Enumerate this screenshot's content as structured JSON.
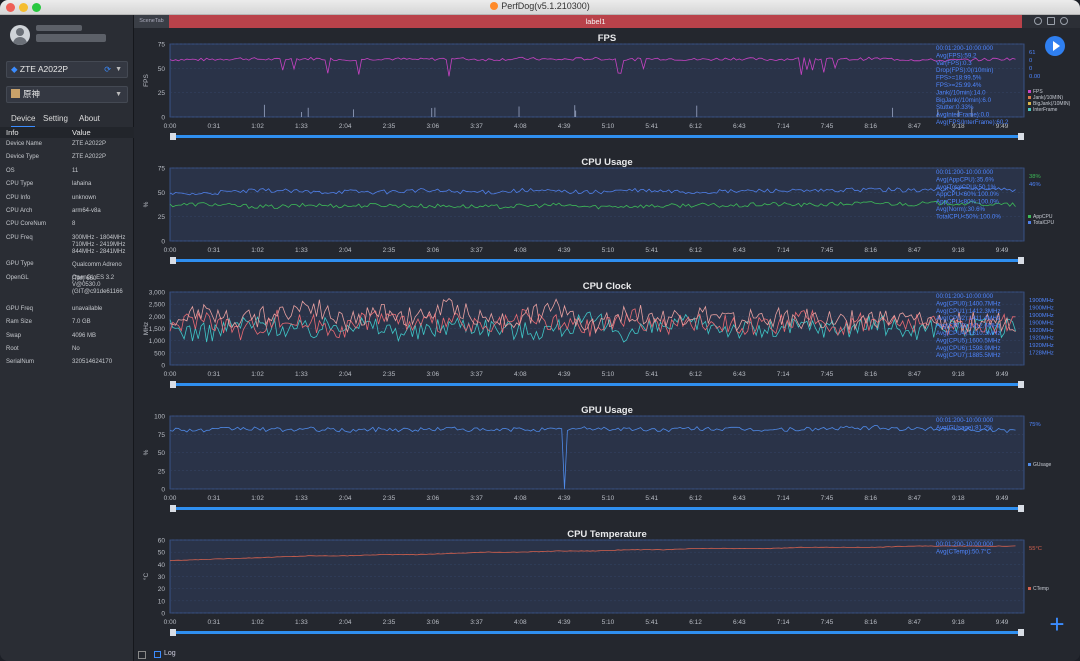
{
  "window": {
    "title": "PerfDog(v5.1.210300)",
    "tab_scene": "SceneTab",
    "tab_label": "label1",
    "status_log": "Log"
  },
  "sidebar": {
    "device_select": "ZTE A2022P",
    "app_select": "原神",
    "tabs": [
      "Device",
      "Setting",
      "About"
    ],
    "info_header": {
      "key": "Info",
      "value": "Value"
    },
    "rows": [
      {
        "k": "Device Name",
        "v": "ZTE A2022P"
      },
      {
        "k": "Device Type",
        "v": "ZTE A2022P"
      },
      {
        "k": "OS",
        "v": "11"
      },
      {
        "k": "CPU Type",
        "v": "lahaina"
      },
      {
        "k": "CPU Info",
        "v": "unknown"
      },
      {
        "k": "CPU Arch",
        "v": "arm64-v8a"
      },
      {
        "k": "CPU CoreNum",
        "v": "8"
      },
      {
        "k": "CPU Freq",
        "v": "300MHz - 1804MHz\n710MHz - 2419MHz\n844MHz - 2841MHz"
      },
      {
        "k": "GPU Type",
        "v": "Qualcomm Adreno (TM) 660"
      },
      {
        "k": "OpenGL",
        "v": "OpenGL ES 3.2 V@0530.0 (GIT@c91de61166"
      },
      {
        "k": "GPU Freq",
        "v": "unavailable"
      },
      {
        "k": "Ram Size",
        "v": "7.0 GB"
      },
      {
        "k": "Swap",
        "v": "4096 MB"
      },
      {
        "k": "Root",
        "v": "No"
      },
      {
        "k": "SerialNum",
        "v": "320514624170"
      }
    ]
  },
  "colors": {
    "accent": "#2f7ff0",
    "label_bar": "#b9424a",
    "plot_bg": "#2a3348",
    "fps": "#c843c4",
    "app_cpu": "#3dbb58",
    "total_cpu": "#4f7fe8",
    "gpu": "#4f8ae8",
    "temp": "#d4614e"
  },
  "x_ticks": [
    "0:00",
    "0:31",
    "1:02",
    "1:33",
    "2:04",
    "2:35",
    "3:06",
    "3:37",
    "4:08",
    "4:39",
    "5:10",
    "5:41",
    "6:12",
    "6:43",
    "7:14",
    "7:45",
    "8:16",
    "8:47",
    "9:18",
    "9:49"
  ],
  "chart_data": [
    {
      "type": "line",
      "title": "FPS",
      "ylabel": "FPS",
      "ylim": [
        0,
        75
      ],
      "yticks": [
        "0",
        "25",
        "50",
        "75"
      ],
      "stats": [
        "00:01:200-10:00:000",
        "Avg(FPS):59.2",
        "Var(FPS):0.3",
        "Drop(FPS):0(/10min)",
        "FPS>=18:99.5%",
        "FPS>=25:99.4%",
        "Jank(/10min):14.0",
        "BigJank(/10min):6.0",
        "Stutter:0.33%",
        "AvgInterFrame):0.0",
        "Avg(FPS/InterFrame):60.2"
      ],
      "current_values": [
        "61",
        "0",
        "0",
        "0.00"
      ],
      "legend": [
        "FPS",
        "Jank(/10MIN)",
        "BigJank(/10MIN)",
        "InterFrame"
      ],
      "legend_colors": [
        "#c843c4",
        "#d97a4c",
        "#d9b54c",
        "#4cc9c0"
      ],
      "series": [
        {
          "name": "FPS",
          "values": [
            59,
            59,
            60,
            59,
            60,
            59,
            60,
            59,
            60,
            59,
            60,
            59,
            60,
            59,
            60,
            59,
            60,
            59,
            60,
            59,
            60,
            59,
            58,
            59,
            60
          ]
        }
      ]
    },
    {
      "type": "line",
      "title": "CPU Usage",
      "ylabel": "%",
      "ylim": [
        0,
        75
      ],
      "yticks": [
        "0",
        "25",
        "50",
        "75"
      ],
      "stats": [
        "00:01:200-10:00:000",
        "Avg(AppCPU):35.6%",
        "Avg(TotalCPU):50.1%",
        "AppCPU<60%:100.0%",
        "AppCPU<80%:100.0%",
        "Avg(Norm):30.6%",
        "TotalCPU<50%:100.0%"
      ],
      "current_values": [
        "38%",
        "46%"
      ],
      "legend": [
        "AppCPU",
        "TotalCPU"
      ],
      "series": [
        {
          "name": "AppCPU",
          "values": [
            37,
            38,
            36,
            35,
            37,
            36,
            37,
            36,
            36,
            35,
            36,
            37,
            35,
            36,
            36,
            37,
            36,
            38,
            37,
            38,
            39,
            38,
            39,
            38,
            37
          ]
        },
        {
          "name": "TotalCPU",
          "values": [
            48,
            49,
            51,
            52,
            50,
            51,
            50,
            52,
            51,
            50,
            52,
            51,
            50,
            52,
            51,
            50,
            51,
            52,
            51,
            52,
            53,
            52,
            53,
            54,
            52
          ]
        }
      ]
    },
    {
      "type": "line",
      "title": "CPU Clock",
      "ylabel": "MHz",
      "ylim": [
        0,
        3000
      ],
      "yticks": [
        "0",
        "500",
        "1,000",
        "1,500",
        "2,000",
        "2,500",
        "3,000"
      ],
      "stats": [
        "00:01:200-10:00:000",
        "Avg(CPU0):1400.7MHz",
        "Avg(CPU1):1412.3MHz",
        "Avg(CPU2):1411.4MHz",
        "Avg(CPU3):1412.6MHz",
        "Avg(CPU4):1610.3MHz",
        "Avg(CPU5):1600.5MHz",
        "Avg(CPU6):1598.9MHz",
        "Avg(CPU7):1885.5MHz"
      ],
      "current_values": [
        "1900MHz",
        "1900MHz",
        "1900MHz",
        "1900MHz",
        "1920MHz",
        "1920MHz",
        "1920MHz",
        "1728MHz"
      ],
      "series": [
        {
          "name": "CPU0-3",
          "values": [
            1500,
            1300,
            1700,
            1600,
            1400,
            1800,
            1500,
            1300,
            1700,
            1600,
            1400,
            1500,
            1800,
            1300,
            1600,
            1700,
            1500,
            1400,
            1600,
            1500,
            1700,
            1400,
            1600,
            1500,
            1500
          ]
        },
        {
          "name": "CPU4-6",
          "values": [
            1600,
            2000,
            1400,
            1900,
            1700,
            1500,
            2100,
            1600,
            1800,
            1400,
            1900,
            1700,
            1500,
            2000,
            1600,
            1800,
            1700,
            1500,
            1900,
            1600,
            1800,
            1700,
            1600,
            1700,
            1650
          ]
        },
        {
          "name": "CPU7",
          "values": [
            1900,
            2300,
            1800,
            2100,
            2500,
            1700,
            2200,
            1900,
            2400,
            1800,
            2000,
            2300,
            1700,
            2200,
            1900,
            2100,
            1800,
            2000,
            1900,
            1800,
            1900,
            1800,
            1750,
            1800,
            1728
          ]
        }
      ]
    },
    {
      "type": "line",
      "title": "GPU Usage",
      "ylabel": "%",
      "ylim": [
        0,
        100
      ],
      "yticks": [
        "0",
        "25",
        "50",
        "75",
        "100"
      ],
      "stats": [
        "00:01:200-10:00:000",
        "Avg(GUsage):81.2%"
      ],
      "current_values": [
        "75%"
      ],
      "legend": [
        "GUsage"
      ],
      "series": [
        {
          "name": "GUsage",
          "values": [
            82,
            80,
            83,
            81,
            82,
            80,
            82,
            81,
            83,
            80,
            82,
            81,
            83,
            82,
            81,
            83,
            82,
            81,
            82,
            83,
            84,
            82,
            83,
            81,
            80
          ]
        }
      ]
    },
    {
      "type": "line",
      "title": "CPU Temperature",
      "ylabel": "°C",
      "ylim": [
        0,
        60
      ],
      "yticks": [
        "0",
        "10",
        "20",
        "30",
        "40",
        "50",
        "60"
      ],
      "stats": [
        "00:01:200-10:00:000",
        "Avg(CTemp):50.7°C"
      ],
      "current_values": [
        "55°C"
      ],
      "legend": [
        "CTemp"
      ],
      "series": [
        {
          "name": "CTemp",
          "values": [
            43,
            44,
            45,
            46,
            47,
            47,
            48,
            48,
            49,
            50,
            50,
            51,
            51,
            52,
            52,
            53,
            53,
            53,
            54,
            54,
            54,
            55,
            55,
            55,
            55
          ]
        }
      ]
    }
  ]
}
